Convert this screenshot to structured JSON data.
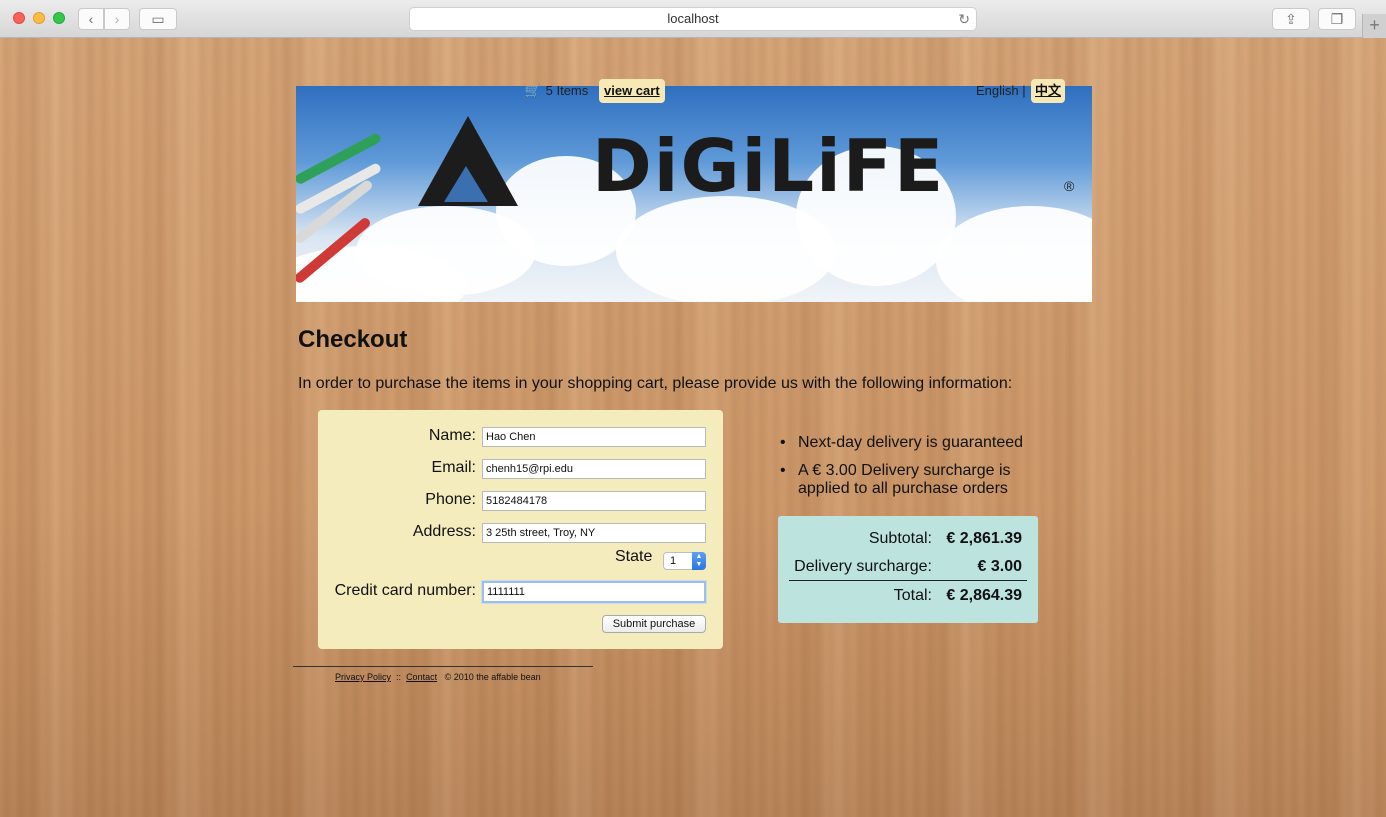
{
  "browser": {
    "url": "localhost",
    "icons": {
      "back": "chevron-left-icon",
      "forward": "chevron-right-icon",
      "sidebar": "sidebar-icon",
      "reload": "reload-icon",
      "share": "share-icon",
      "tabs": "tabs-icon",
      "new_tab": "plus-icon"
    }
  },
  "header": {
    "cart_count": "5 Items",
    "view_cart_label": "view cart",
    "lang_english": "English |",
    "lang_chinese": "中文",
    "logo_text": "DiGiLiFE",
    "logo_reg": "®"
  },
  "checkout": {
    "title": "Checkout",
    "intro": "In order to purchase the items in your shopping cart, please provide us with the following information:",
    "form": {
      "name_label": "Name:",
      "name_value": "Hao Chen",
      "email_label": "Email:",
      "email_value": "chenh15@rpi.edu",
      "phone_label": "Phone:",
      "phone_value": "5182484178",
      "address_label": "Address:",
      "address_value": "3 25th street, Troy, NY",
      "state_label": "State",
      "state_value": "1",
      "cc_label": "Credit card number:",
      "cc_value": "1111111",
      "submit_label": "Submit purchase"
    },
    "info": [
      "Next-day delivery is guaranteed",
      "A € 3.00 Delivery surcharge is applied to all purchase orders"
    ],
    "totals": {
      "subtotal_label": "Subtotal:",
      "subtotal_value": "€ 2,861.39",
      "surcharge_label": "Delivery surcharge:",
      "surcharge_value": "€ 3.00",
      "total_label": "Total:",
      "total_value": "€ 2,864.39"
    }
  },
  "footer": {
    "privacy": "Privacy Policy",
    "sep": "::",
    "contact": "Contact",
    "copyright": "©   2010 the affable bean"
  },
  "colors": {
    "form_bg": "#f4ecbd",
    "totals_bg": "#bde3df",
    "header_button_bg": "#f6e9b6"
  }
}
